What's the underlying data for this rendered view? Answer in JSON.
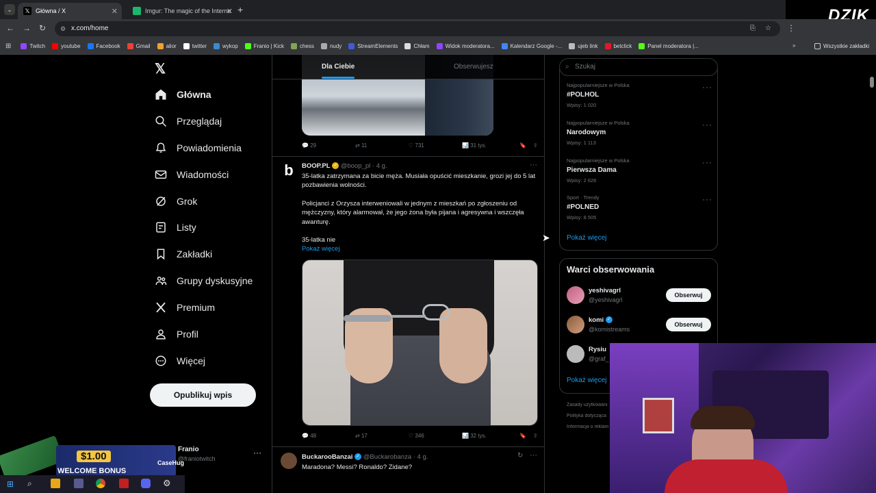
{
  "tabs": [
    {
      "title": "Główna / X"
    },
    {
      "title": "Imgur: The magic of the Interne"
    }
  ],
  "address": "x.com/home",
  "bookmarks": [
    "Twitch",
    "youtube",
    "Facebook",
    "Gmail",
    "alior",
    "twitter",
    "wykop",
    "Franio | Kick",
    "chess",
    "nudy",
    "StreamElements",
    "Chłam",
    "Widok moderatora...",
    "Kalendarz Google -...",
    "ujeb link",
    "betclick",
    "Panel moderatora |..."
  ],
  "all_bookmarks": "Wszystkie zakładki",
  "logo_text": "DZIK",
  "nav": {
    "home": "Główna",
    "explore": "Przeglądaj",
    "notifications": "Powiadomienia",
    "messages": "Wiadomości",
    "grok": "Grok",
    "lists": "Listy",
    "bookmarks": "Zakładki",
    "communities": "Grupy dyskusyjne",
    "premium": "Premium",
    "profile": "Profil",
    "more": "Więcej",
    "post": "Opublikuj wpis"
  },
  "account": {
    "name": "Franio",
    "handle": "@franiotwitch"
  },
  "feed_tabs": {
    "for_you": "Dla Ciebie",
    "following": "Obserwujesz"
  },
  "tweet0": {
    "replies": "29",
    "retweets": "11",
    "likes": "731",
    "views": "31 tys."
  },
  "tweet1": {
    "name": "BOOP.PL",
    "handle": "@boop_pl",
    "time": "· 4 g.",
    "p1": "35-latka zatrzymana za bicie męża. Musiała opuścić mieszkanie, grozi jej do 5 lat pozbawienia wolności.",
    "p2": "Policjanci z Orzysza interweniowali w jednym z mieszkań po zgłoszeniu od mężczyzny, który alarmował, że jego żona była pijana i agresywna i wszczęła awanturę.",
    "p3": "35-latka nie",
    "show_more": "Pokaż więcej",
    "replies": "48",
    "retweets": "17",
    "likes": "346",
    "views": "32 tys."
  },
  "tweet2": {
    "name": "BuckarooBanzai",
    "handle": "@Buckarobanza",
    "time": "· 4 g.",
    "text": "Maradona? Messi? Ronaldo? Zidane?"
  },
  "search": {
    "placeholder": "Szukaj"
  },
  "trends": [
    {
      "category": "Najpopularniejsze w Polska",
      "name": "#POLHOL",
      "count": "Wpisy: 1 020"
    },
    {
      "category": "Najpopularniejsze w Polska",
      "name": "Narodowym",
      "count": "Wpisy: 1 113"
    },
    {
      "category": "Najpopularniejsze w Polska",
      "name": "Pierwsza Dama",
      "count": "Wpisy: 2 626"
    },
    {
      "category": "Sport · Trendy",
      "name": "#POLNED",
      "count": "Wpisy: 8 505"
    }
  ],
  "trends_more": "Pokaż więcej",
  "who_to_follow": {
    "title": "Warci obserwowania",
    "users": [
      {
        "name": "yeshivagrl",
        "handle": "@yeshivagrl",
        "button": "Obserwuj"
      },
      {
        "name": "komi",
        "handle": "@komistreams",
        "button": "Obserwuj"
      },
      {
        "name": "Rysiu",
        "handle": "@graf_"
      }
    ],
    "more": "Pokaż więcej"
  },
  "footer_links": [
    "Zasady użytkowani",
    "Polityka dotycząca",
    "Informacja o reklam"
  ],
  "promo": {
    "amount": "$1.00",
    "text": "WELCOME BONUS",
    "brand": "CaseHug"
  },
  "colors": {
    "accent": "#1d9bf0",
    "bg": "#000000",
    "border": "#2f3336",
    "muted": "#71767b"
  }
}
